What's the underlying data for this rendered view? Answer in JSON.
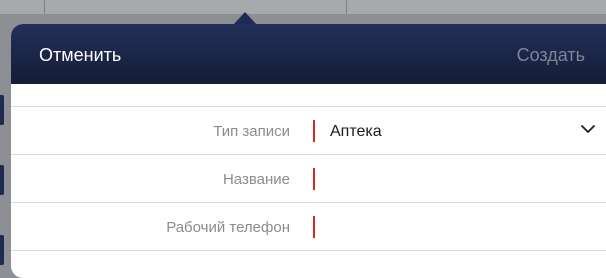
{
  "navbar": {
    "cancel_label": "Отменить",
    "create_label": "Создать"
  },
  "form": {
    "rows": [
      {
        "label": "Тип записи",
        "value": "Аптека",
        "required": true,
        "type": "select"
      },
      {
        "label": "Название",
        "value": "",
        "required": true,
        "type": "text"
      },
      {
        "label": "Рабочий телефон",
        "value": "",
        "required": true,
        "type": "text"
      }
    ]
  },
  "colors": {
    "navbar_top": "#22305a",
    "navbar_bottom": "#151c37",
    "required_marker": "#e3212d",
    "disabled_text": "#7f8499"
  },
  "icons": {
    "select_indicator": "chevron-down-icon"
  }
}
